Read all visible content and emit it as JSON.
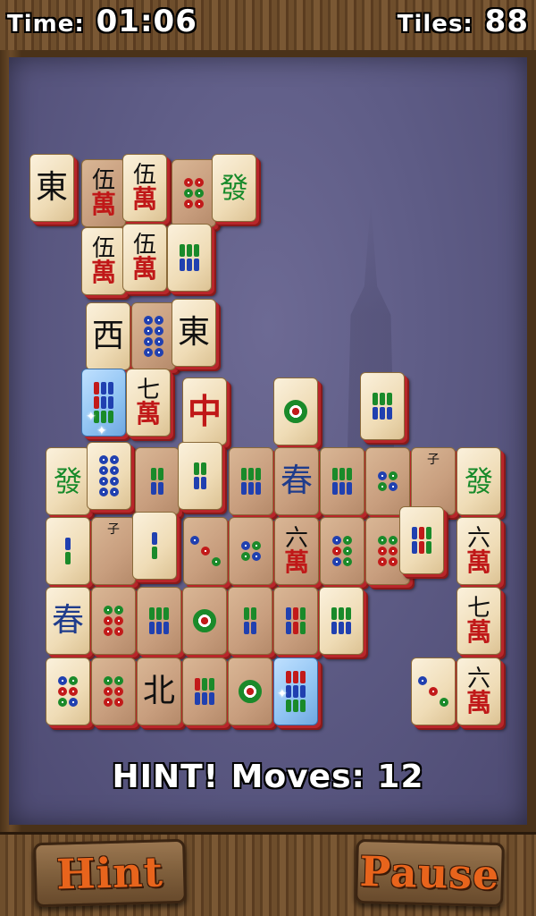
{
  "hud": {
    "time_label": "Time:",
    "time_value": "01:06",
    "tiles_label": "Tiles:",
    "tiles_value": "88"
  },
  "status": "HINT!  Moves:  12",
  "buttons": {
    "hint": "Hint",
    "pause": "Pause"
  },
  "tile_glyphs": {
    "east": "東",
    "west": "西",
    "north": "北",
    "green_dragon": "發",
    "red_dragon": "中",
    "spring": "春",
    "five_wan_top": "伍",
    "six_wan_top": "六",
    "seven_wan_top": "七",
    "wan": "萬",
    "bamboo_zi": "子"
  },
  "colors": {
    "tile_edge": "#b8262a",
    "board": "#5e5c86",
    "button_text": "#e8641c"
  }
}
